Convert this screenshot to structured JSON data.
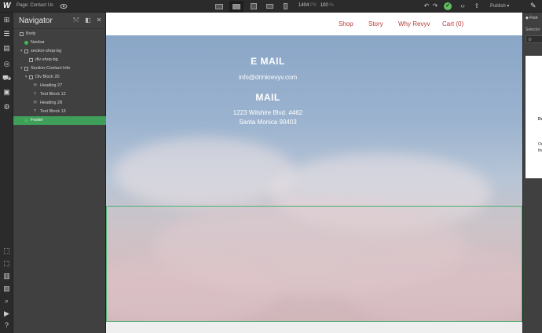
{
  "topbar": {
    "logo": "W",
    "page_label": "Page: Contact Us",
    "width": "1404",
    "width_unit": "PX",
    "zoom": "100",
    "zoom_unit": "%",
    "publish_label": "Publish"
  },
  "navigator": {
    "title": "Navigator",
    "items": [
      {
        "label": "Body",
        "depth": 0,
        "caret": "",
        "icon": "box"
      },
      {
        "label": "Navbar",
        "depth": 1,
        "caret": "",
        "icon": "symbol"
      },
      {
        "label": "section-shop-bg",
        "depth": 1,
        "caret": "▾",
        "icon": "box"
      },
      {
        "label": "div-shop-bg",
        "depth": 2,
        "caret": "",
        "icon": "box"
      },
      {
        "label": "Section-Contact-Info",
        "depth": 1,
        "caret": "▾",
        "icon": "box"
      },
      {
        "label": "Div Block 20",
        "depth": 2,
        "caret": "▾",
        "icon": "box"
      },
      {
        "label": "Heading 27",
        "depth": 3,
        "caret": "",
        "icon": "heading"
      },
      {
        "label": "Text Block 12",
        "depth": 3,
        "caret": "",
        "icon": "text"
      },
      {
        "label": "Heading 28",
        "depth": 3,
        "caret": "",
        "icon": "heading"
      },
      {
        "label": "Text Block 13",
        "depth": 3,
        "caret": "",
        "icon": "text"
      },
      {
        "label": "Footer",
        "depth": 1,
        "caret": "",
        "icon": "symbol",
        "selected": true
      }
    ]
  },
  "site": {
    "nav_links": [
      "Shop",
      "Story",
      "Why Revyv",
      "Cart (0)"
    ],
    "email_heading": "E MAIL",
    "email": "info@drinkrevyv.com",
    "mail_heading": "MAIL",
    "address_line1": "1223 Wilshire Blvd. #462",
    "address_line2": "Santa Monica 90403"
  },
  "right_panel": {
    "selected_label": "Foot",
    "selector_label": "Selector",
    "text1": "Do",
    "text2": "Or",
    "text3": "the"
  },
  "colors": {
    "accent_green": "#3f9e5a",
    "nav_link": "#b83a3a",
    "sky_top": "#8aa6c6",
    "sky_bottom": "#cfb0b4"
  }
}
